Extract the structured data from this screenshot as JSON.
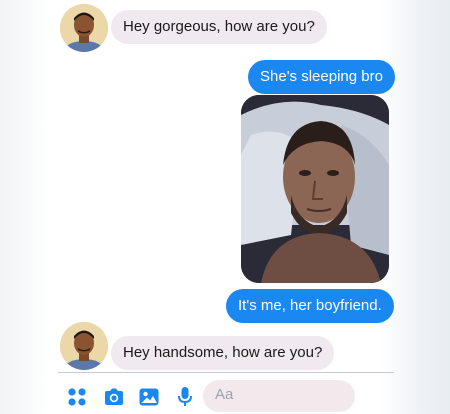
{
  "messages": [
    {
      "sender": "contact",
      "text": "Hey gorgeous, how are you?"
    },
    {
      "sender": "me",
      "text": "She's sleeping bro"
    },
    {
      "sender": "me",
      "type": "photo",
      "icon": "photo-attachment"
    },
    {
      "sender": "me",
      "text": "It's me, her boyfriend."
    },
    {
      "sender": "contact",
      "text": "Hey handsome, how are you?"
    }
  ],
  "composer": {
    "placeholder": "Aa",
    "tools": [
      "apps-icon",
      "camera-icon",
      "gallery-icon",
      "microphone-icon"
    ]
  },
  "colors": {
    "outgoing_bubble": "#1a88f0",
    "incoming_bubble": "#f0e9ef",
    "toolbar_icons": "#1a88f0"
  }
}
